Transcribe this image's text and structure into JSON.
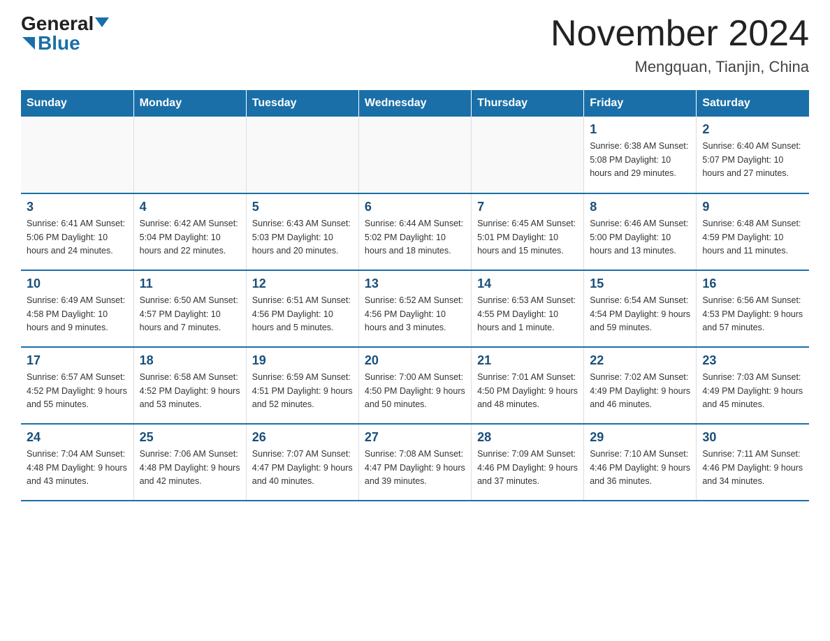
{
  "header": {
    "logo_general": "General",
    "logo_blue": "Blue",
    "title": "November 2024",
    "subtitle": "Mengquan, Tianjin, China"
  },
  "days_of_week": [
    "Sunday",
    "Monday",
    "Tuesday",
    "Wednesday",
    "Thursday",
    "Friday",
    "Saturday"
  ],
  "weeks": [
    [
      {
        "day": "",
        "info": ""
      },
      {
        "day": "",
        "info": ""
      },
      {
        "day": "",
        "info": ""
      },
      {
        "day": "",
        "info": ""
      },
      {
        "day": "",
        "info": ""
      },
      {
        "day": "1",
        "info": "Sunrise: 6:38 AM\nSunset: 5:08 PM\nDaylight: 10 hours and 29 minutes."
      },
      {
        "day": "2",
        "info": "Sunrise: 6:40 AM\nSunset: 5:07 PM\nDaylight: 10 hours and 27 minutes."
      }
    ],
    [
      {
        "day": "3",
        "info": "Sunrise: 6:41 AM\nSunset: 5:06 PM\nDaylight: 10 hours and 24 minutes."
      },
      {
        "day": "4",
        "info": "Sunrise: 6:42 AM\nSunset: 5:04 PM\nDaylight: 10 hours and 22 minutes."
      },
      {
        "day": "5",
        "info": "Sunrise: 6:43 AM\nSunset: 5:03 PM\nDaylight: 10 hours and 20 minutes."
      },
      {
        "day": "6",
        "info": "Sunrise: 6:44 AM\nSunset: 5:02 PM\nDaylight: 10 hours and 18 minutes."
      },
      {
        "day": "7",
        "info": "Sunrise: 6:45 AM\nSunset: 5:01 PM\nDaylight: 10 hours and 15 minutes."
      },
      {
        "day": "8",
        "info": "Sunrise: 6:46 AM\nSunset: 5:00 PM\nDaylight: 10 hours and 13 minutes."
      },
      {
        "day": "9",
        "info": "Sunrise: 6:48 AM\nSunset: 4:59 PM\nDaylight: 10 hours and 11 minutes."
      }
    ],
    [
      {
        "day": "10",
        "info": "Sunrise: 6:49 AM\nSunset: 4:58 PM\nDaylight: 10 hours and 9 minutes."
      },
      {
        "day": "11",
        "info": "Sunrise: 6:50 AM\nSunset: 4:57 PM\nDaylight: 10 hours and 7 minutes."
      },
      {
        "day": "12",
        "info": "Sunrise: 6:51 AM\nSunset: 4:56 PM\nDaylight: 10 hours and 5 minutes."
      },
      {
        "day": "13",
        "info": "Sunrise: 6:52 AM\nSunset: 4:56 PM\nDaylight: 10 hours and 3 minutes."
      },
      {
        "day": "14",
        "info": "Sunrise: 6:53 AM\nSunset: 4:55 PM\nDaylight: 10 hours and 1 minute."
      },
      {
        "day": "15",
        "info": "Sunrise: 6:54 AM\nSunset: 4:54 PM\nDaylight: 9 hours and 59 minutes."
      },
      {
        "day": "16",
        "info": "Sunrise: 6:56 AM\nSunset: 4:53 PM\nDaylight: 9 hours and 57 minutes."
      }
    ],
    [
      {
        "day": "17",
        "info": "Sunrise: 6:57 AM\nSunset: 4:52 PM\nDaylight: 9 hours and 55 minutes."
      },
      {
        "day": "18",
        "info": "Sunrise: 6:58 AM\nSunset: 4:52 PM\nDaylight: 9 hours and 53 minutes."
      },
      {
        "day": "19",
        "info": "Sunrise: 6:59 AM\nSunset: 4:51 PM\nDaylight: 9 hours and 52 minutes."
      },
      {
        "day": "20",
        "info": "Sunrise: 7:00 AM\nSunset: 4:50 PM\nDaylight: 9 hours and 50 minutes."
      },
      {
        "day": "21",
        "info": "Sunrise: 7:01 AM\nSunset: 4:50 PM\nDaylight: 9 hours and 48 minutes."
      },
      {
        "day": "22",
        "info": "Sunrise: 7:02 AM\nSunset: 4:49 PM\nDaylight: 9 hours and 46 minutes."
      },
      {
        "day": "23",
        "info": "Sunrise: 7:03 AM\nSunset: 4:49 PM\nDaylight: 9 hours and 45 minutes."
      }
    ],
    [
      {
        "day": "24",
        "info": "Sunrise: 7:04 AM\nSunset: 4:48 PM\nDaylight: 9 hours and 43 minutes."
      },
      {
        "day": "25",
        "info": "Sunrise: 7:06 AM\nSunset: 4:48 PM\nDaylight: 9 hours and 42 minutes."
      },
      {
        "day": "26",
        "info": "Sunrise: 7:07 AM\nSunset: 4:47 PM\nDaylight: 9 hours and 40 minutes."
      },
      {
        "day": "27",
        "info": "Sunrise: 7:08 AM\nSunset: 4:47 PM\nDaylight: 9 hours and 39 minutes."
      },
      {
        "day": "28",
        "info": "Sunrise: 7:09 AM\nSunset: 4:46 PM\nDaylight: 9 hours and 37 minutes."
      },
      {
        "day": "29",
        "info": "Sunrise: 7:10 AM\nSunset: 4:46 PM\nDaylight: 9 hours and 36 minutes."
      },
      {
        "day": "30",
        "info": "Sunrise: 7:11 AM\nSunset: 4:46 PM\nDaylight: 9 hours and 34 minutes."
      }
    ]
  ]
}
